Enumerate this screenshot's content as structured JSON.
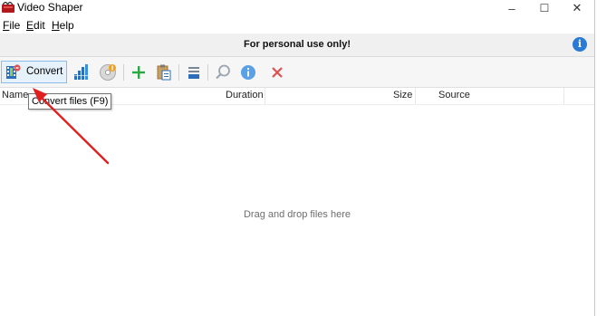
{
  "app": {
    "title": "Video Shaper"
  },
  "window_controls": {
    "minimize": "–",
    "maximize": "☐",
    "close": "✕"
  },
  "menu": [
    {
      "label": "File",
      "accel": "F",
      "rest": "ile"
    },
    {
      "label": "Edit",
      "accel": "E",
      "rest": "dit"
    },
    {
      "label": "Help",
      "accel": "H",
      "rest": "elp"
    }
  ],
  "notice": {
    "text": "For personal use only!",
    "info_glyph": "i"
  },
  "toolbar": {
    "convert_label": "Convert",
    "icons": [
      "convert-film-icon",
      "bar-chart-icon",
      "disc-icon",
      "add-icon",
      "paste-icon",
      "queue-icon",
      "search-icon",
      "info-icon",
      "delete-icon"
    ],
    "colors": {
      "add": "#2aa845",
      "delete": "#e0504f",
      "info": "#2a7ad5",
      "disc": "#f0a020"
    }
  },
  "tooltip": {
    "text": "Convert files (F9)"
  },
  "columns": {
    "name": "Name",
    "duration": "Duration",
    "size": "Size",
    "source": "Source"
  },
  "list": {
    "empty_text": "Drag and drop files here"
  },
  "annotation": {
    "arrow_color": "#e02020"
  }
}
